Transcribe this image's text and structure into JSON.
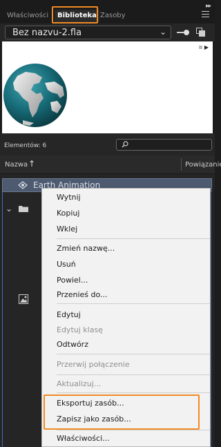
{
  "tabs": [
    {
      "label": "Właściwości",
      "active": false
    },
    {
      "label": "Biblioteka",
      "active": true
    },
    {
      "label": "Zasoby",
      "active": false
    }
  ],
  "document": {
    "selected": "Bez nazvu-2.fla"
  },
  "library": {
    "count_label": "Elementów: 6",
    "search_value": "",
    "columns": {
      "name": "Nazwa",
      "linkage": "Powiązanie"
    },
    "items": [
      {
        "label": "Earth Animation",
        "icon": "movieclip-symbol-icon",
        "selected": true
      },
      {
        "label": "",
        "icon": "folder-icon",
        "expanded": true
      },
      {
        "label": "",
        "icon": "bitmap-icon"
      }
    ]
  },
  "context_menu": {
    "groups": [
      [
        "Wytnij",
        "Kopiuj",
        "Wklej"
      ],
      [
        "Zmień nazwę...",
        "Usuń",
        "Powiel...",
        "Przenieś do..."
      ],
      [
        "Edytuj",
        "Edytuj klasę",
        "Odtwórz"
      ],
      [
        "Przerwij połączenie"
      ],
      [
        "Aktualizuj..."
      ],
      [
        "Eksportuj zasób...",
        "Zapisz jako zasób..."
      ],
      [
        "Właściwości..."
      ]
    ],
    "disabled": [
      "Edytuj klasę",
      "Przerwij połączenie",
      "Aktualizuj..."
    ]
  },
  "colors": {
    "highlight_outline": "#f08a24",
    "selection": "#4d5a70",
    "panel_bg": "#252525"
  }
}
